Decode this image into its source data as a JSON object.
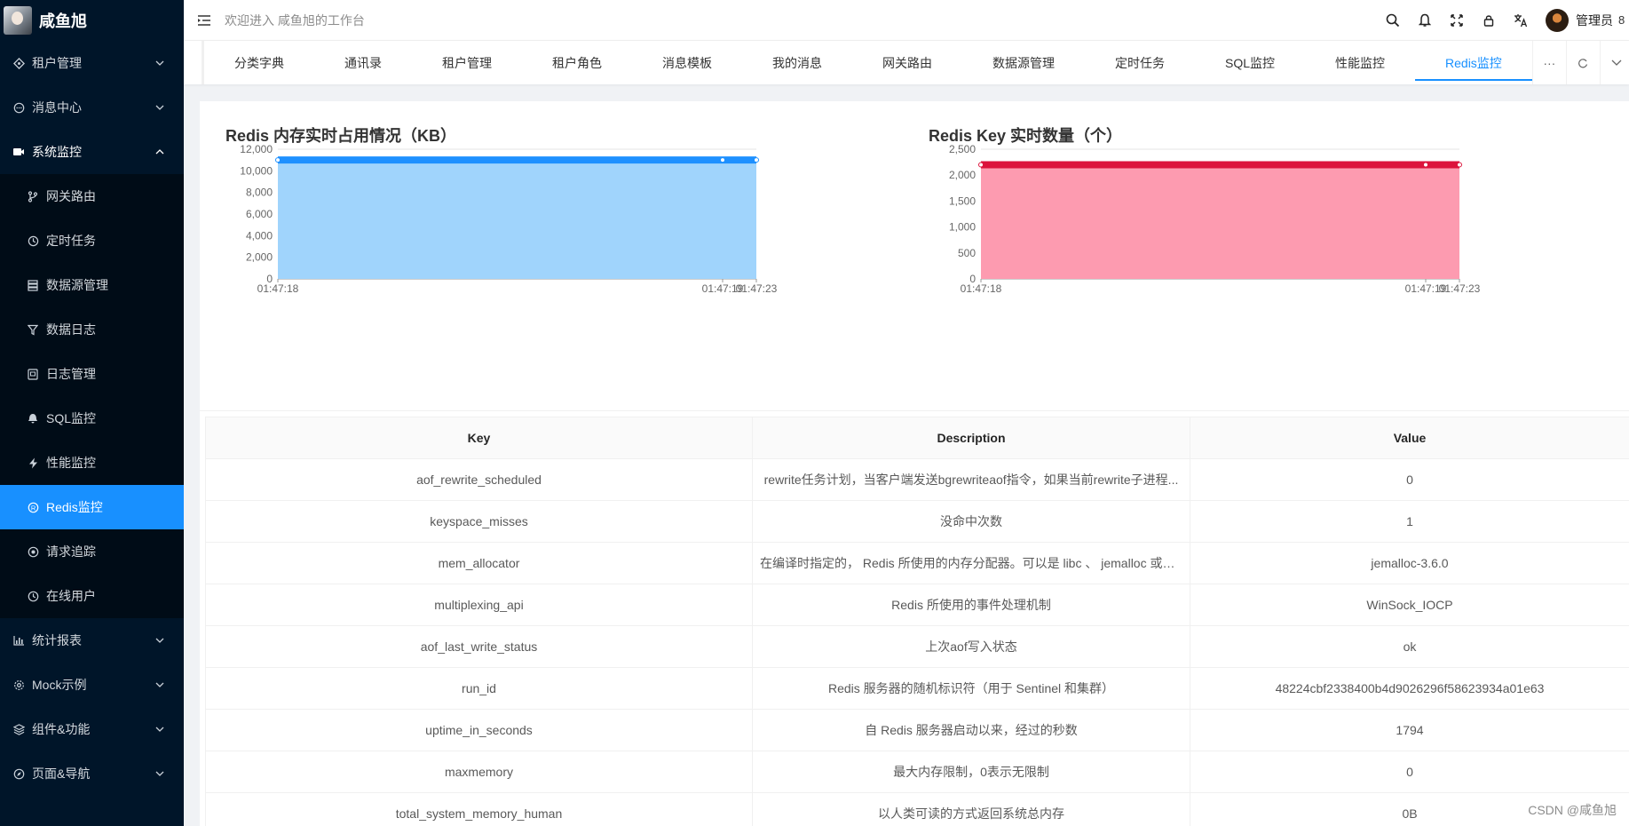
{
  "app": {
    "title": "咸鱼旭",
    "welcome": "欢迎进入 咸鱼旭的工作台"
  },
  "header": {
    "user_name": "管理员",
    "extra": "8"
  },
  "sidebar": {
    "items": [
      {
        "label": "租户管理",
        "icon": "tenant-icon"
      },
      {
        "label": "消息中心",
        "icon": "message-icon"
      },
      {
        "label": "系统监控",
        "icon": "monitor-icon"
      }
    ],
    "sub_items": [
      {
        "label": "网关路由",
        "icon": "route-icon"
      },
      {
        "label": "定时任务",
        "icon": "clock-icon"
      },
      {
        "label": "数据源管理",
        "icon": "database-icon"
      },
      {
        "label": "数据日志",
        "icon": "filter-icon"
      },
      {
        "label": "日志管理",
        "icon": "log-icon"
      },
      {
        "label": "SQL监控",
        "icon": "sql-icon"
      },
      {
        "label": "性能监控",
        "icon": "lightning-icon"
      },
      {
        "label": "Redis监控",
        "icon": "redis-icon"
      },
      {
        "label": "请求追踪",
        "icon": "trace-icon"
      },
      {
        "label": "在线用户",
        "icon": "online-icon"
      }
    ],
    "bottom_items": [
      {
        "label": "统计报表",
        "icon": "chart-icon"
      },
      {
        "label": "Mock示例",
        "icon": "gear-icon"
      },
      {
        "label": "组件&功能",
        "icon": "layers-icon"
      },
      {
        "label": "页面&导航",
        "icon": "compass-icon"
      }
    ]
  },
  "tabs": [
    "分类字典",
    "通讯录",
    "租户管理",
    "租户角色",
    "消息模板",
    "我的消息",
    "网关路由",
    "数据源管理",
    "定时任务",
    "SQL监控",
    "性能监控",
    "Redis监控"
  ],
  "tab_more": "···",
  "colors": {
    "accent": "#1890ff",
    "memory_fill": "#a0d4fc",
    "memory_line": "#1e90ff",
    "key_fill": "#fd9bb0",
    "key_line": "#dc143c",
    "sidebar_bg": "#001529"
  },
  "chart_data": [
    {
      "type": "area",
      "title": "Redis 内存实时占用情况（KB）",
      "x": [
        "01:47:18",
        "01:47:19",
        "01:47:23"
      ],
      "series": [
        {
          "values": [
            11000,
            11000,
            11000
          ]
        }
      ],
      "yticks": [
        "0",
        "2,000",
        "4,000",
        "6,000",
        "8,000",
        "10,000",
        "12,000"
      ],
      "ylim": [
        0,
        12000
      ],
      "grid": true
    },
    {
      "type": "area",
      "title": "Redis Key 实时数量（个）",
      "x": [
        "01:47:18",
        "01:47:19",
        "01:47:23"
      ],
      "series": [
        {
          "values": [
            2200,
            2200,
            2200
          ]
        }
      ],
      "yticks": [
        "0",
        "500",
        "1,000",
        "1,500",
        "2,000",
        "2,500"
      ],
      "ylim": [
        0,
        2500
      ],
      "grid": true
    }
  ],
  "table": {
    "headers": [
      "Key",
      "Description",
      "Value"
    ],
    "rows": [
      [
        "aof_rewrite_scheduled",
        "rewrite任务计划，当客户端发送bgrewriteaof指令，如果当前rewrite子进程...",
        "0"
      ],
      [
        "keyspace_misses",
        "没命中次数",
        "1"
      ],
      [
        "mem_allocator",
        "在编译时指定的， Redis 所使用的内存分配器。可以是 libc 、 jemalloc 或者...",
        "jemalloc-3.6.0"
      ],
      [
        "multiplexing_api",
        "Redis 所使用的事件处理机制",
        "WinSock_IOCP"
      ],
      [
        "aof_last_write_status",
        "上次aof写入状态",
        "ok"
      ],
      [
        "run_id",
        "Redis 服务器的随机标识符（用于 Sentinel 和集群）",
        "48224cbf2338400b4d9026296f58623934a01e63"
      ],
      [
        "uptime_in_seconds",
        "自 Redis 服务器启动以来，经过的秒数",
        "1794"
      ],
      [
        "maxmemory",
        "最大内存限制，0表示无限制",
        "0"
      ],
      [
        "total_system_memory_human",
        "以人类可读的方式返回系统总内存",
        "0B"
      ]
    ]
  },
  "watermark": "CSDN @咸鱼旭"
}
